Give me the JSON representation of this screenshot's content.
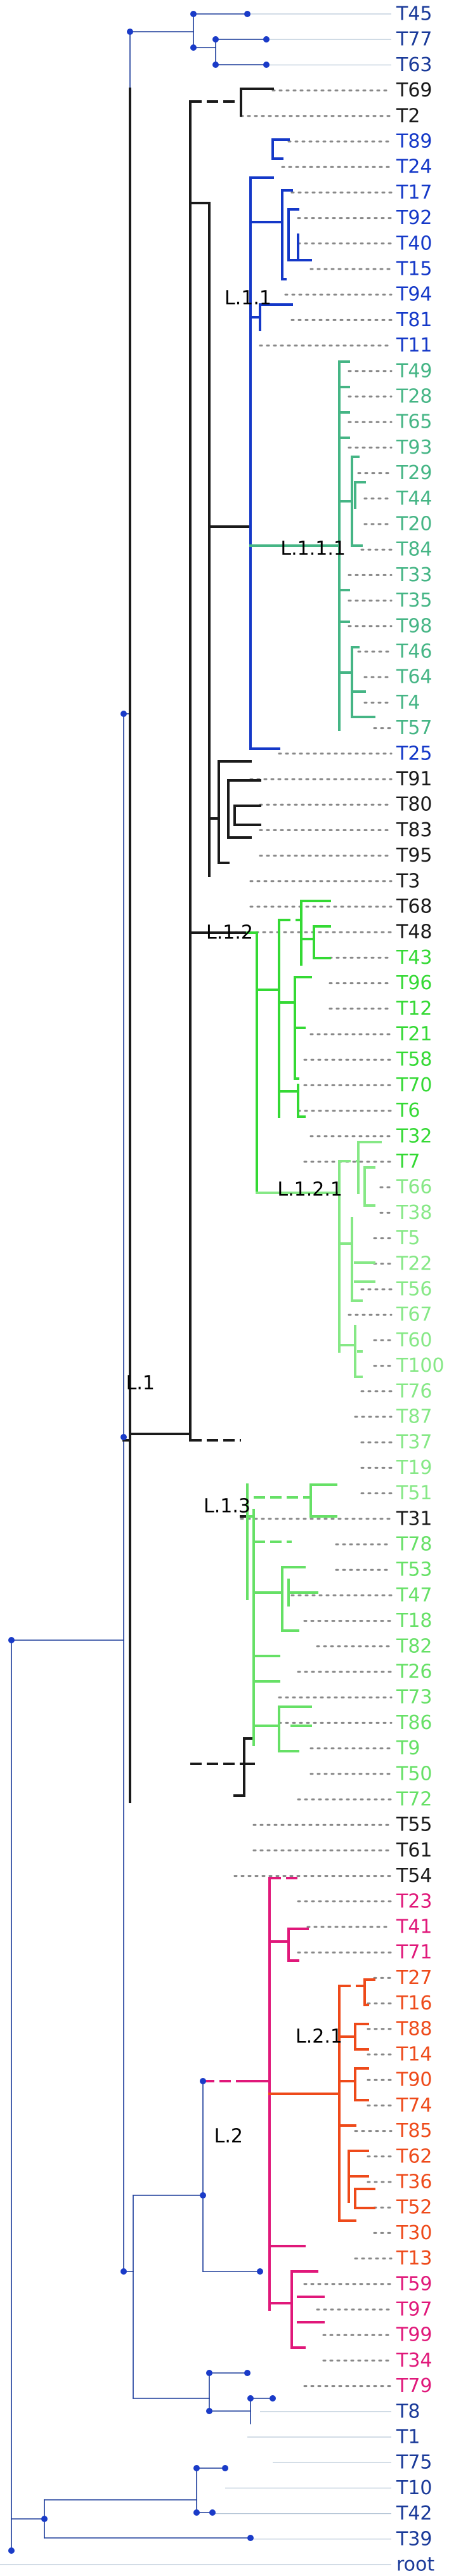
{
  "colors": {
    "dark": "#1a1a1a",
    "blue": "#1438c8",
    "teal": "#45b585",
    "green": "#34d934",
    "light_green": "#86e886",
    "lime": "#66e066",
    "magenta": "#e0187a",
    "orange": "#ee4a1a",
    "navy": "#1a3a99",
    "node": "#1a3bc8",
    "guide": "#b8c8d8",
    "dots": "#888888"
  },
  "clade_labels": [
    "L.1.1",
    "L.1.1.1",
    "L.1.2",
    "L.1.2.1",
    "L.1",
    "L.1.3",
    "L.2.1",
    "L.2"
  ],
  "tips": [
    "T45",
    "T77",
    "T63",
    "T69",
    "T2",
    "T89",
    "T24",
    "T17",
    "T92",
    "T40",
    "T15",
    "T94",
    "T81",
    "T11",
    "T49",
    "T28",
    "T65",
    "T93",
    "T29",
    "T44",
    "T20",
    "T84",
    "T33",
    "T35",
    "T98",
    "T46",
    "T64",
    "T4",
    "T57",
    "T25",
    "T91",
    "T80",
    "T83",
    "T95",
    "T3",
    "T68",
    "T48",
    "T43",
    "T96",
    "T12",
    "T21",
    "T58",
    "T70",
    "T6",
    "T32",
    "T7",
    "T66",
    "T38",
    "T5",
    "T22",
    "T56",
    "T67",
    "T60",
    "T100",
    "T76",
    "T87",
    "T37",
    "T19",
    "T51",
    "T31",
    "T78",
    "T53",
    "T47",
    "T18",
    "T82",
    "T26",
    "T73",
    "T86",
    "T9",
    "T50",
    "T72",
    "T55",
    "T61",
    "T54",
    "T23",
    "T41",
    "T71",
    "T27",
    "T16",
    "T88",
    "T14",
    "T90",
    "T74",
    "T85",
    "T62",
    "T36",
    "T52",
    "T30",
    "T13",
    "T59",
    "T97",
    "T99",
    "T34",
    "T79",
    "T8",
    "T1",
    "T75",
    "T10",
    "T42",
    "T39",
    "root"
  ]
}
